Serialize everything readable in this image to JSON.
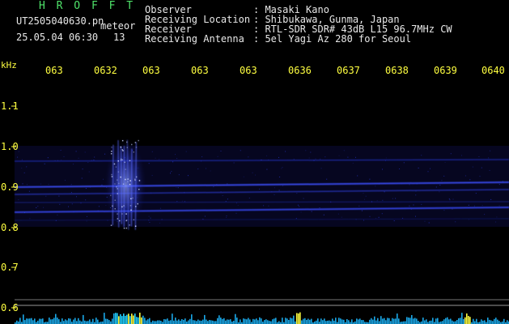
{
  "header": {
    "app_name": "H R O F F T",
    "filename": "UT2505040630.pn",
    "tag": "meteor",
    "datetime": "25.05.04 06:30",
    "count": "13",
    "observer_label": "Observer",
    "observer_value": ": Masaki Kano",
    "location_label": "Receiving Location",
    "location_value": ": Shibukawa, Gunma, Japan",
    "receiver_label": "Receiver",
    "receiver_value": ": RTL-SDR SDR# 43dB L15 96.7MHz CW",
    "antenna_label": "Receiving Antenna",
    "antenna_value": ": 5el Yagi Az 280 for Seoul"
  },
  "axis": {
    "unit": "kHz",
    "time_ticks": [
      "063",
      "0632",
      "063",
      "063",
      "063",
      "0636",
      "0637",
      "0638",
      "0639",
      "0640"
    ],
    "freq_ticks": [
      "1.1",
      "1.0",
      "0.9",
      "0.8",
      "0.7",
      "0.6"
    ]
  },
  "colors": {
    "background": "#000000",
    "header_green": "#4fe36a",
    "header_white": "#e8e8e8",
    "axis_yellow": "#ffff40",
    "signal_blue": "#3a4cff",
    "spectrum_cyan": "#20d0ff"
  }
}
